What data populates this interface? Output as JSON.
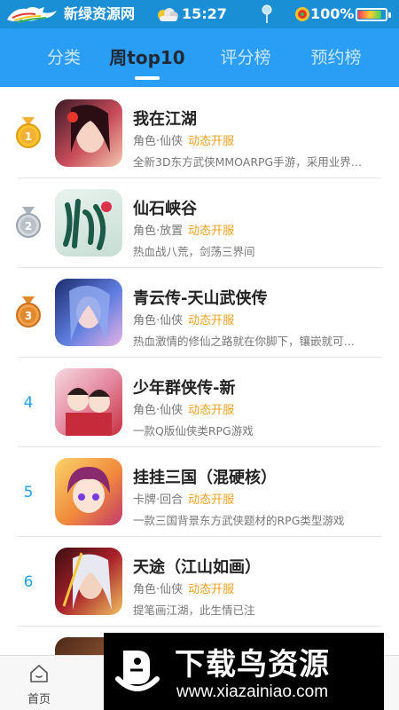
{
  "status_bar": {
    "site_name": "新绿资源网",
    "time": "15:27",
    "battery": "100%"
  },
  "tabs": [
    {
      "label": "分类",
      "active": false
    },
    {
      "label": "周top10",
      "active": true
    },
    {
      "label": "评分榜",
      "active": false
    },
    {
      "label": "预约榜",
      "active": false
    }
  ],
  "apps": [
    {
      "rank": "1",
      "medal": "gold",
      "name": "我在江湖",
      "category": "角色·仙侠",
      "status": "动态开服",
      "desc": "全新3D东方武侠MMOARPG手游，采用业界…"
    },
    {
      "rank": "2",
      "medal": "silver",
      "name": "仙石峡谷",
      "category": "角色·放置",
      "status": "动态开服",
      "desc": "热血战八荒，剑荡三界间"
    },
    {
      "rank": "3",
      "medal": "bronze",
      "name": "青云传-天山武侠传",
      "category": "角色·仙侠",
      "status": "动态开服",
      "desc": "热血激情的修仙之路就在你脚下，镶嵌就可…"
    },
    {
      "rank": "4",
      "name": "少年群侠传-新",
      "category": "角色·仙侠",
      "status": "动态开服",
      "desc": "一款Q版仙侠类RPG游戏"
    },
    {
      "rank": "5",
      "name": "挂挂三国（混硬核）",
      "category": "卡牌·回合",
      "status": "动态开服",
      "desc": "一款三国背景东方武侠题材的RPG类型游戏"
    },
    {
      "rank": "6",
      "name": "天途（江山如画）",
      "category": "角色·仙侠",
      "status": "动态开服",
      "desc": "提笔画江湖，此生情已注"
    }
  ],
  "bottom_nav": {
    "home_label": "首页"
  },
  "watermark": {
    "title": "下载鸟资源",
    "url": "www.xiazainiao.com"
  },
  "colors": {
    "status_bar": "#1b8fd6",
    "tab_bar": "#2a9df4",
    "accent_tag": "#f0a020",
    "rank_number": "#1fa3e8"
  }
}
